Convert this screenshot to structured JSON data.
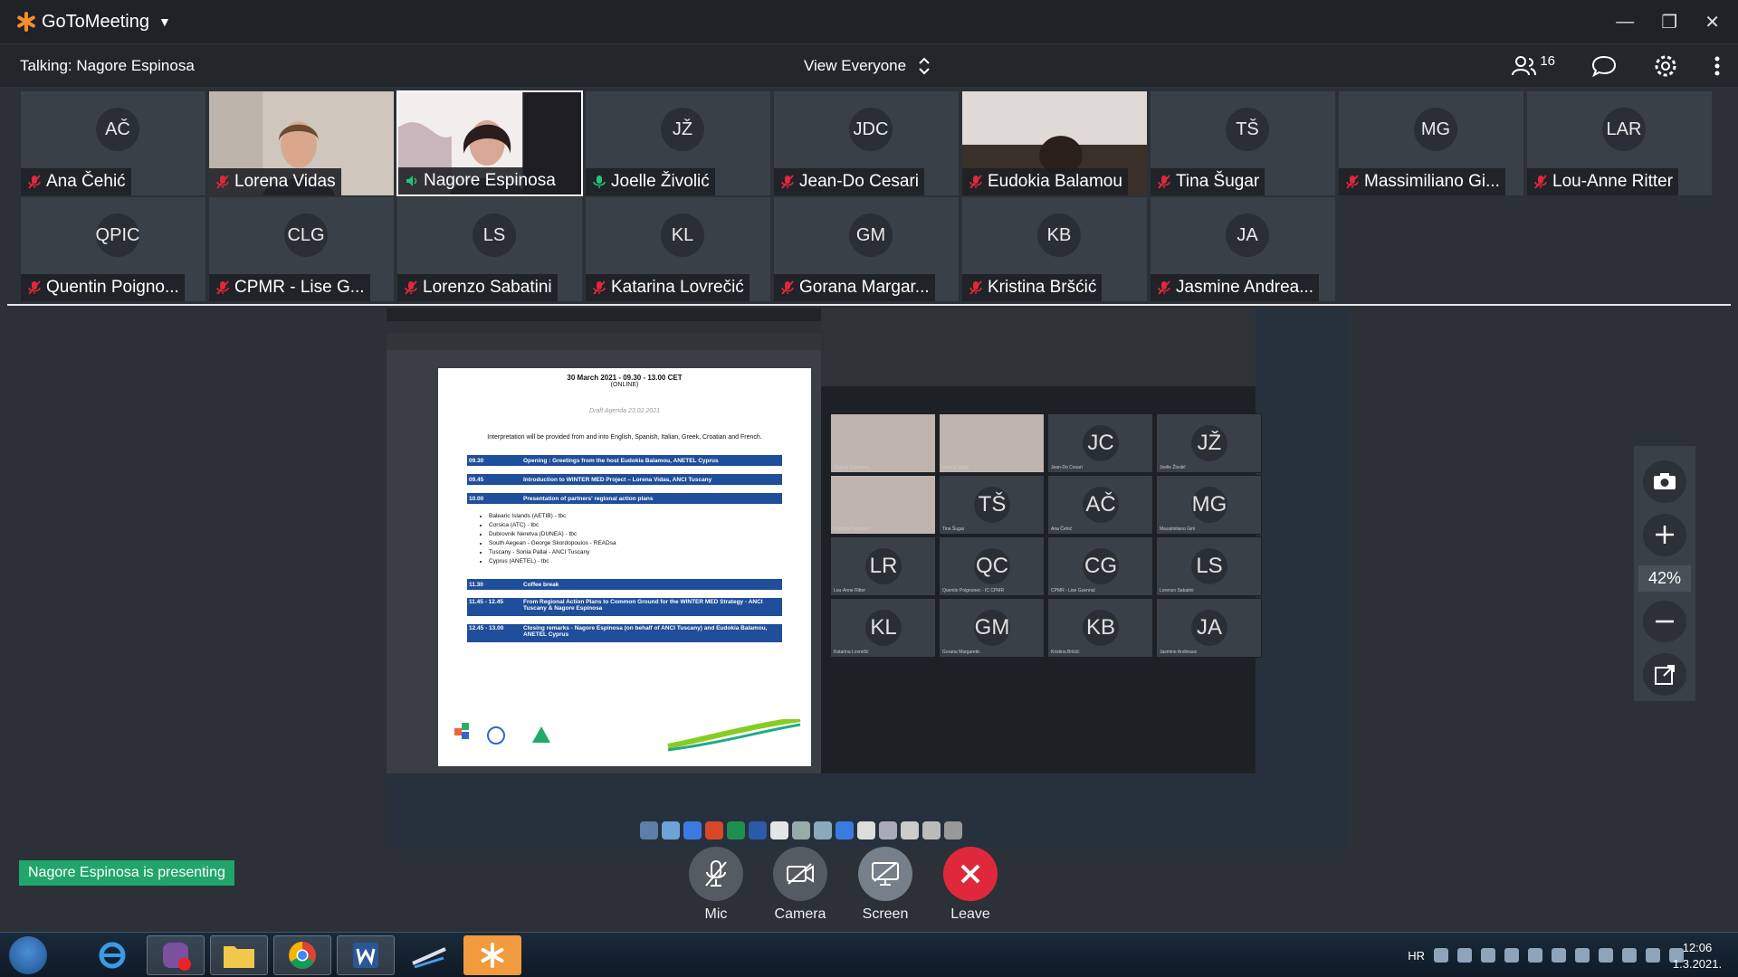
{
  "app": {
    "brand": "GoToMeeting",
    "talking": "Talking: Nagore Espinosa",
    "view_selector": "View Everyone",
    "participant_count": "16"
  },
  "participants": [
    {
      "initials": "AČ",
      "name": "Ana Čehić",
      "muted": true,
      "video": false,
      "active": false
    },
    {
      "initials": "",
      "name": "Lorena Vidas",
      "muted": true,
      "video": true,
      "active": false
    },
    {
      "initials": "",
      "name": "Nagore Espinosa",
      "muted": false,
      "video": true,
      "active": true
    },
    {
      "initials": "JŽ",
      "name": "Joelle Živolić",
      "muted": false,
      "video": false,
      "active": false
    },
    {
      "initials": "JDC",
      "name": "Jean-Do Cesari",
      "muted": true,
      "video": false,
      "active": false
    },
    {
      "initials": "",
      "name": "Eudokia Balamou",
      "muted": true,
      "video": true,
      "active": false
    },
    {
      "initials": "TŠ",
      "name": "Tina Šugar",
      "muted": true,
      "video": false,
      "active": false
    },
    {
      "initials": "MG",
      "name": "Massimiliano Gi...",
      "muted": true,
      "video": false,
      "active": false
    },
    {
      "initials": "LAR",
      "name": "Lou-Anne Ritter",
      "muted": true,
      "video": false,
      "active": false
    },
    {
      "initials": "QPIC",
      "name": "Quentin Poigno...",
      "muted": true,
      "video": false,
      "active": false
    },
    {
      "initials": "CLG",
      "name": "CPMR -   Lise G...",
      "muted": true,
      "video": false,
      "active": false
    },
    {
      "initials": "LS",
      "name": "Lorenzo Sabatini",
      "muted": true,
      "video": false,
      "active": false
    },
    {
      "initials": "KL",
      "name": "Katarina Lovrečić",
      "muted": true,
      "video": false,
      "active": false
    },
    {
      "initials": "GM",
      "name": "Gorana Margar...",
      "muted": true,
      "video": false,
      "active": false
    },
    {
      "initials": "KB",
      "name": "Kristina Bršćić",
      "muted": true,
      "video": false,
      "active": false
    },
    {
      "initials": "JA",
      "name": "Jasmine Andrea...",
      "muted": true,
      "video": false,
      "active": false
    }
  ],
  "shared_doc": {
    "title": "30 March 2021 - 09.30 - 13.00 CET",
    "subtitle": "(ONLINE)",
    "draft": "Draft Agenda 23.02.2021",
    "intro": "Interpretation will be provided from and into English, Spanish, Italian, Greek, Croatian and French.",
    "agenda": [
      {
        "time": "09.30",
        "text": "Opening : Greetings from the host Eudokia Balamou, ANETEL Cyprus"
      },
      {
        "time": "09.45",
        "text": "Introduction to WINTER MED Project – Lorena Vidas, ANCI Tuscany"
      },
      {
        "time": "10.00",
        "text": "Presentation of partners' regional action plans"
      }
    ],
    "bullets": [
      "Balearic Islands (AETIB) - tbc",
      "Corsica (ATC) - tbc",
      "Dubrovnik Neretva (DUNEA) - tbc",
      "South Aegean - George Skordopoulos - READsa",
      "Tuscany - Sonia Pallai - ANCI Tuscany",
      "Cyprus (ANETEL) - tbc"
    ],
    "agenda2": [
      {
        "time": "11.30",
        "text": "Coffee break"
      },
      {
        "time": "11.45 - 12.45",
        "text": "From Regional Action Plans to Common Ground for the WINTER MED Strategy - ANCI Tuscany & Nagore Espinosa"
      },
      {
        "time": "12.45 - 13.00",
        "text": "Closing remarks - Nagore Espinosa (on behalf of ANCI Tuscany) and Eudokia Balamou, ANETEL Cyprus"
      }
    ]
  },
  "mini_grid": [
    {
      "initials": "",
      "name": "Nagore Espinosa"
    },
    {
      "initials": "",
      "name": "Lorena Vidas"
    },
    {
      "initials": "JC",
      "name": "Jean-Do Cesari"
    },
    {
      "initials": "JŽ",
      "name": "Joelle Živolić"
    },
    {
      "initials": "",
      "name": "Eudokia Balamou"
    },
    {
      "initials": "TŠ",
      "name": "Tina Šugar"
    },
    {
      "initials": "AČ",
      "name": "Ana Čehić"
    },
    {
      "initials": "MG",
      "name": "Massimiliano Gini"
    },
    {
      "initials": "LR",
      "name": "Lou-Anne Ritter"
    },
    {
      "initials": "QC",
      "name": "Quentin Poignonec - IC CPMR"
    },
    {
      "initials": "CG",
      "name": "CPMR - Lise Guennal"
    },
    {
      "initials": "LS",
      "name": "Lorenzo Sabatini"
    },
    {
      "initials": "KL",
      "name": "Katarina Lovrečić"
    },
    {
      "initials": "GM",
      "name": "Gorana Margaretic"
    },
    {
      "initials": "KB",
      "name": "Kristina Bršćić"
    },
    {
      "initials": "JA",
      "name": "Jasmine Andreaus"
    }
  ],
  "zoom": {
    "level": "42%"
  },
  "presenting_badge": "Nagore Espinosa is presenting",
  "controls": {
    "mic": "Mic",
    "camera": "Camera",
    "screen": "Screen",
    "leave": "Leave"
  },
  "taskbar": {
    "lang": "HR",
    "time": "12:06",
    "date": "1.3.2021."
  },
  "colors": {
    "accent": "#f68d2e",
    "presenting": "#21a56a",
    "leave": "#e0283c",
    "agenda_bar": "#1f4e9a"
  }
}
